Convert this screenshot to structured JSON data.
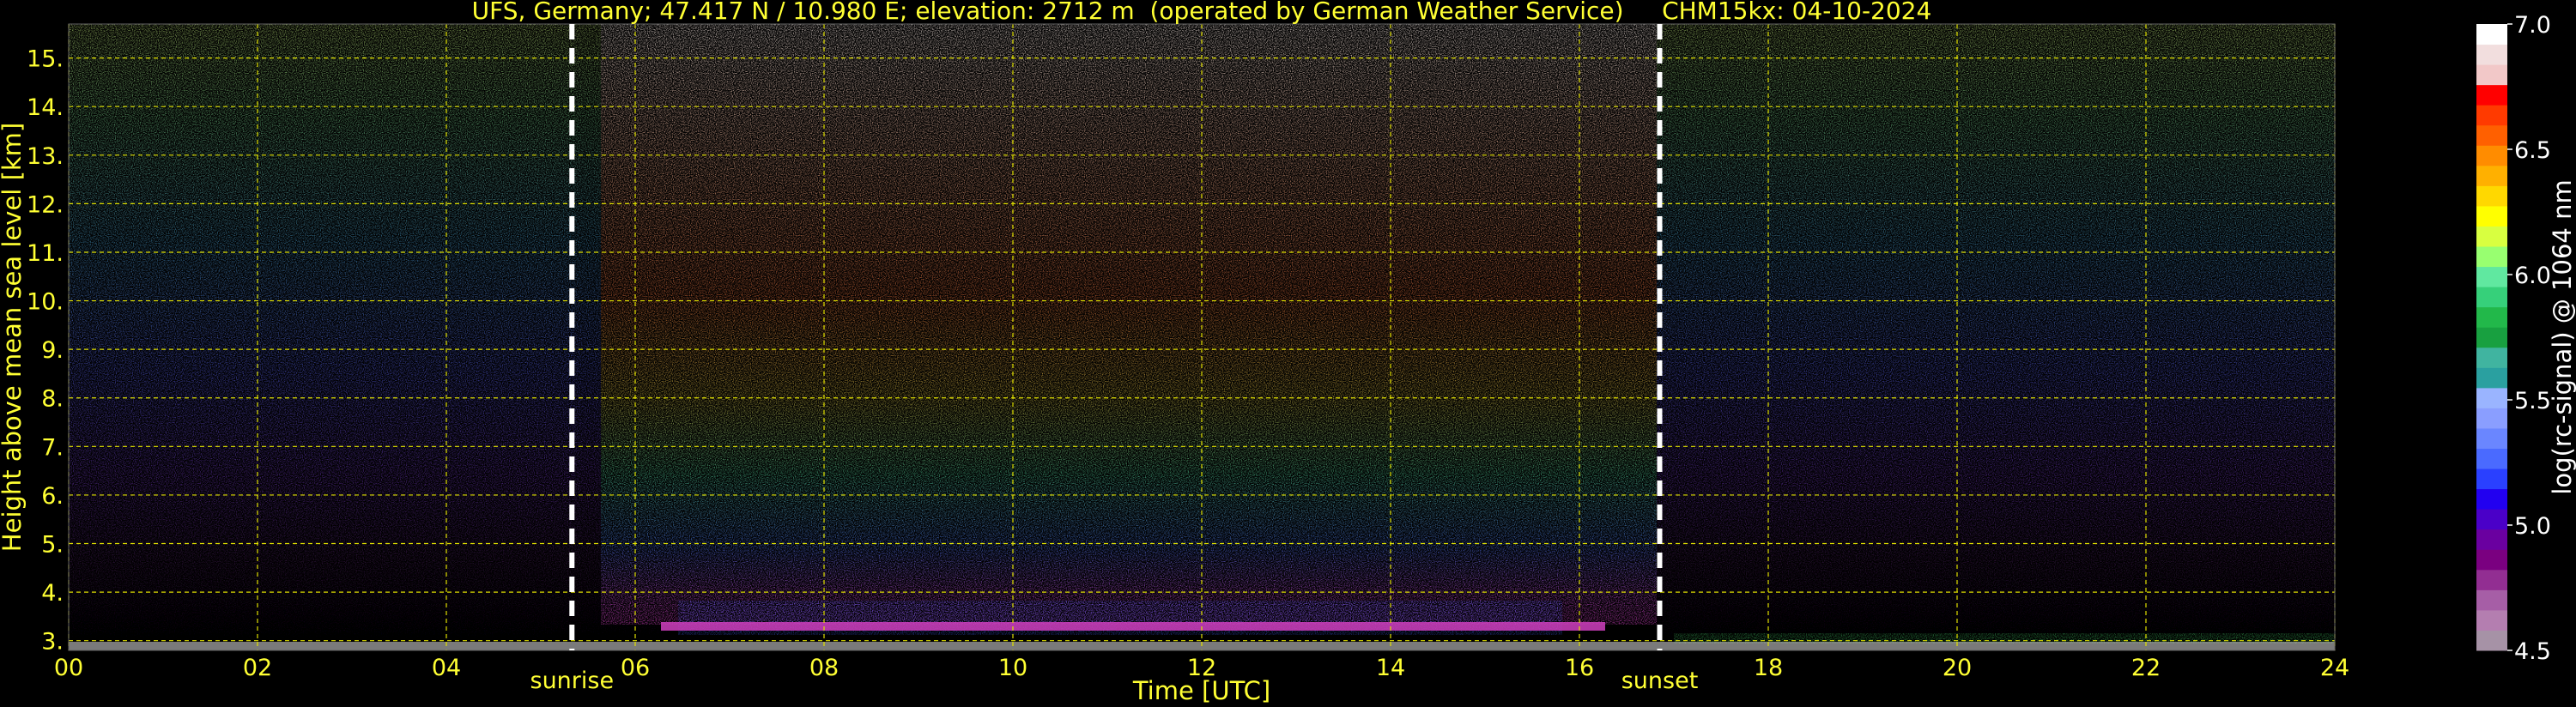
{
  "chart_data": {
    "type": "heatmap",
    "title": "UFS, Germany; 47.417 N / 10.980 E; elevation: 2712 m  (operated by German Weather Service)     CHM15kx: 04-10-2024",
    "xlabel": "Time [UTC]",
    "ylabel": "Height above mean sea level [km]",
    "xlim": [
      0,
      24
    ],
    "ylim": [
      2.8,
      15.7
    ],
    "x_ticks": [
      "00",
      "02",
      "04",
      "06",
      "08",
      "10",
      "12",
      "14",
      "16",
      "18",
      "20",
      "22",
      "24"
    ],
    "y_ticks": [
      "3.",
      "4.",
      "5.",
      "6.",
      "7.",
      "8.",
      "9.",
      "10.",
      "11.",
      "12.",
      "13.",
      "14.",
      "15."
    ],
    "grid": true,
    "annotations": [
      {
        "label": "sunrise",
        "x": 5.33
      },
      {
        "label": "sunset",
        "x": 16.85
      }
    ],
    "colorbar": {
      "label": "log(rc-signal) @ 1064 nm",
      "range": [
        4.5,
        7.0
      ],
      "ticks": [
        "7.0",
        "6.5",
        "6.0",
        "5.5",
        "5.0",
        "4.5"
      ]
    },
    "features": {
      "boundary_layer_top_km": 3.3,
      "daytime_background_noise": "high between sunrise and sunset",
      "nighttime_background": "low"
    }
  },
  "colors": {
    "axis_text": "#ffff33",
    "grid": "#e0e000",
    "background": "#000000",
    "marker_lines": "#ffffff"
  }
}
